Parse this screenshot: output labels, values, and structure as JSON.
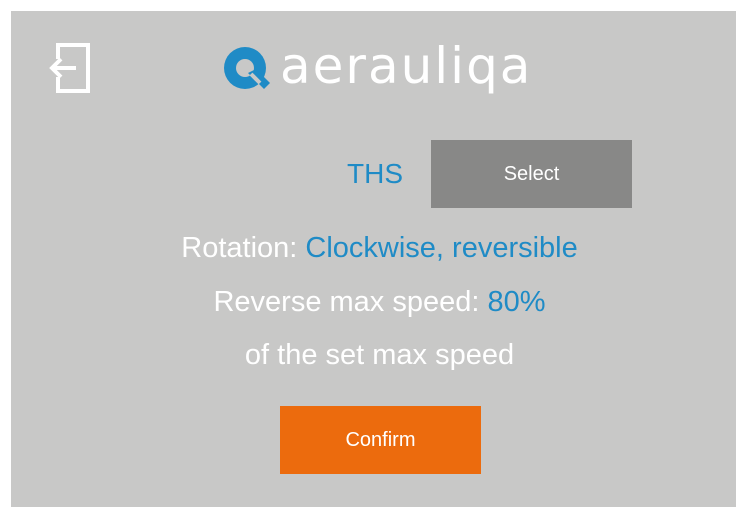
{
  "brand": {
    "name": "aerauliqa",
    "logo_color": "#1f8bc6"
  },
  "colors": {
    "background": "#c8c8c7",
    "accent": "#1f8bc6",
    "confirm": "#ec6b0d",
    "select": "#888887"
  },
  "header": {
    "exit_icon": "exit-icon"
  },
  "selector": {
    "label": "THS",
    "select_label": "Select"
  },
  "info": {
    "rotation_label": "Rotation: ",
    "rotation_value": "Clockwise, reversible",
    "reverse_label": "Reverse max speed: ",
    "reverse_value": "80%",
    "reverse_note": "of the set max speed"
  },
  "actions": {
    "confirm_label": "Confirm"
  }
}
